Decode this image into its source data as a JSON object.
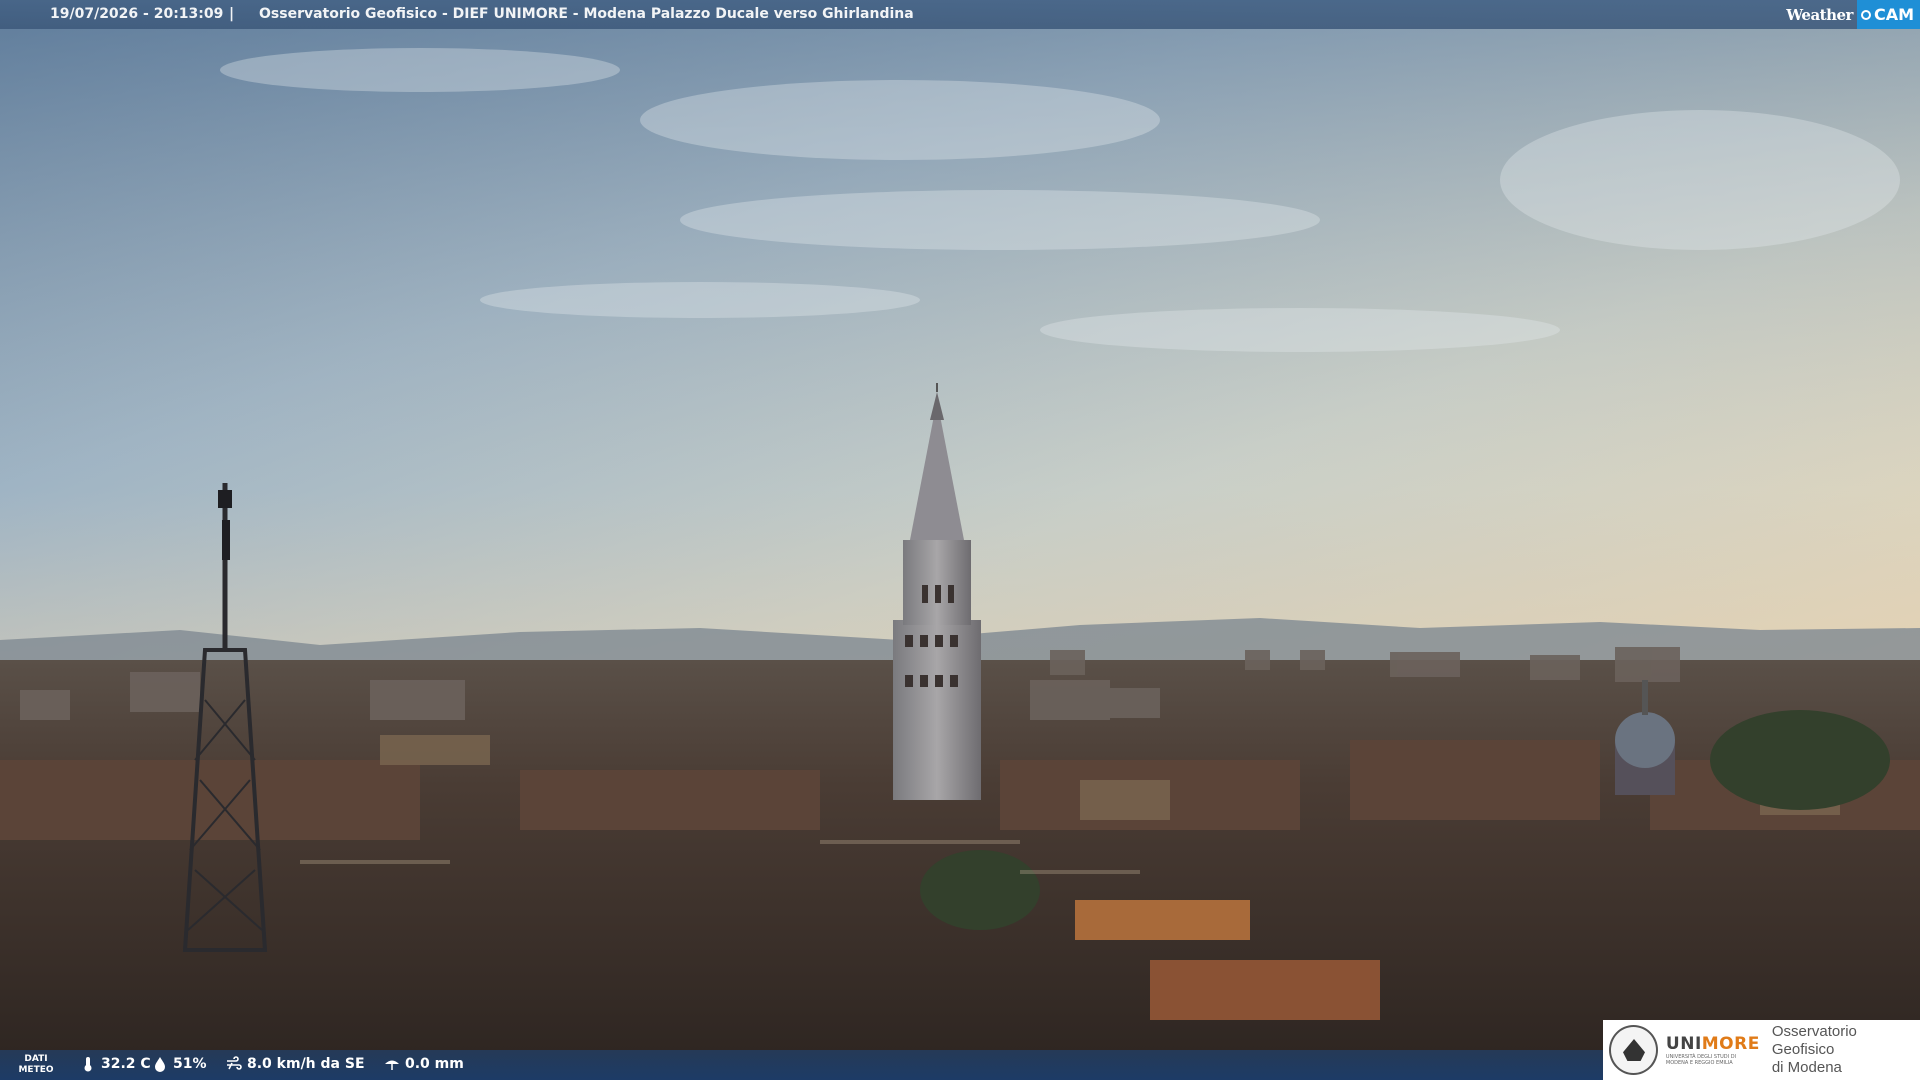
{
  "header": {
    "timestamp": "19/07/2026 - 20:13:09",
    "separator": "|",
    "camera_title": "Osservatorio Geofisico - DIEF UNIMORE - Modena Palazzo Ducale verso Ghirlandina",
    "brand_weather": "Weather",
    "brand_cam": "CAM"
  },
  "weather": {
    "label_line1": "DATI",
    "label_line2": "METEO",
    "temperature": "32.2 C",
    "humidity": "51%",
    "wind": "8.0 km/h da SE",
    "rain": "0.0 mm",
    "icons": [
      "thermometer-icon",
      "humidity-drop-icon",
      "wind-icon",
      "rain-gauge-icon"
    ]
  },
  "logo": {
    "uni_prefix": "UNI",
    "uni_suffix": "MORE",
    "uni_sub": "UNIVERSITÀ DEGLI STUDI DI MODENA E REGGIO EMILIA",
    "observatory_line1": "Osservatorio Geofisico",
    "observatory_line2": "di Modena"
  },
  "colors": {
    "header_bar": "#46648a",
    "brand_cam": "#1f8fd6",
    "unimore_orange": "#e07b18"
  }
}
